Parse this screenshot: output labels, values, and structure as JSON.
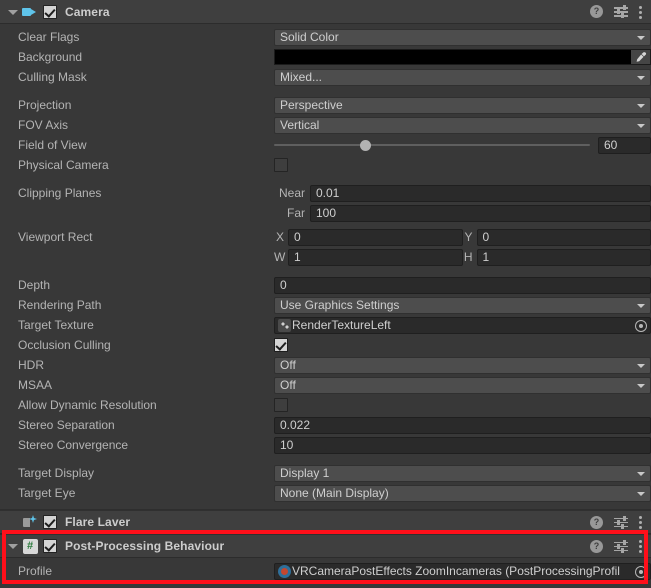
{
  "components": {
    "camera": {
      "title": "Camera",
      "icon": "camera-icon",
      "enabled": true,
      "properties": {
        "clear_flags": {
          "label": "Clear Flags",
          "value": "Solid Color"
        },
        "background": {
          "label": "Background",
          "value": "#000000"
        },
        "culling_mask": {
          "label": "Culling Mask",
          "value": "Mixed..."
        },
        "projection": {
          "label": "Projection",
          "value": "Perspective"
        },
        "fov_axis": {
          "label": "FOV Axis",
          "value": "Vertical"
        },
        "field_of_view": {
          "label": "Field of View",
          "value": "60",
          "slider_percent": 28
        },
        "physical_camera": {
          "label": "Physical Camera",
          "value": false
        },
        "clipping_planes": {
          "label": "Clipping Planes",
          "near_label": "Near",
          "near_value": "0.01",
          "far_label": "Far",
          "far_value": "100"
        },
        "viewport_rect": {
          "label": "Viewport Rect",
          "x_label": "X",
          "x_value": "0",
          "y_label": "Y",
          "y_value": "0",
          "w_label": "W",
          "w_value": "1",
          "h_label": "H",
          "h_value": "1"
        },
        "depth": {
          "label": "Depth",
          "value": "0"
        },
        "rendering_path": {
          "label": "Rendering Path",
          "value": "Use Graphics Settings"
        },
        "target_texture": {
          "label": "Target Texture",
          "value": "RenderTextureLeft"
        },
        "occlusion_culling": {
          "label": "Occlusion Culling",
          "value": true
        },
        "hdr": {
          "label": "HDR",
          "value": "Off"
        },
        "msaa": {
          "label": "MSAA",
          "value": "Off"
        },
        "allow_dynamic_resolution": {
          "label": "Allow Dynamic Resolution",
          "value": false
        },
        "stereo_separation": {
          "label": "Stereo Separation",
          "value": "0.022"
        },
        "stereo_convergence": {
          "label": "Stereo Convergence",
          "value": "10"
        },
        "target_display": {
          "label": "Target Display",
          "value": "Display 1"
        },
        "target_eye": {
          "label": "Target Eye",
          "value": "None (Main Display)"
        }
      }
    },
    "flare_layer": {
      "title": "Flare Laver",
      "icon": "flare-layer-icon",
      "enabled": true
    },
    "post_processing_behaviour": {
      "title": "Post-Processing Behaviour",
      "icon": "csharp-script-icon",
      "enabled": true,
      "properties": {
        "profile": {
          "label": "Profile",
          "value": "VRCameraPostEffects ZoomIncameras (PostProcessingProfil"
        }
      }
    }
  },
  "header_tools": {
    "help_glyph": "?",
    "help_name": "help-icon",
    "preset_name": "preset-icon",
    "menu_name": "context-menu-icon"
  },
  "highlight": {
    "color": "#ff0f1a",
    "target": "post-processing-behaviour"
  }
}
